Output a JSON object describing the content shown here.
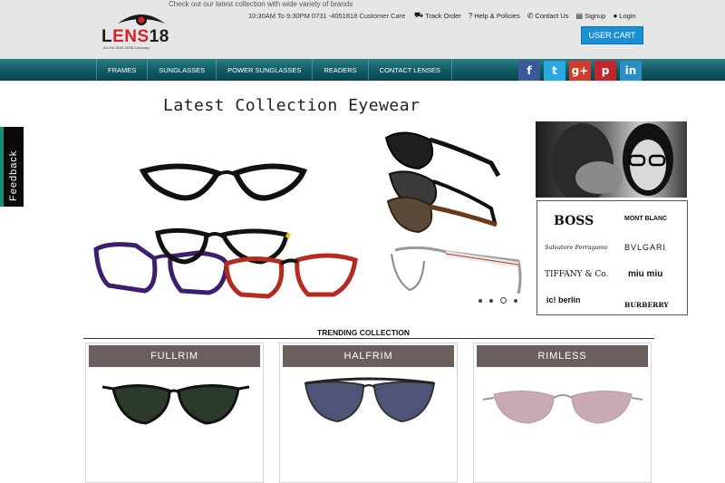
{
  "header": {
    "promo_text": "Check out our latest collection with wide variety of brands",
    "logo_text_a": "L",
    "logo_text_b": "ENS",
    "logo_text_c": "18",
    "logo_tagline": "An ISO 9001:2008 Company",
    "hours": "10:30AM To 9:30PM 0731 -4051818 Customer Care",
    "links": {
      "track_order": "Track Order",
      "help": "Help & Policies",
      "contact": "Contact Us",
      "signup": "Signup",
      "login": "Login"
    },
    "cart_label": "USER CART"
  },
  "nav": {
    "items": [
      "FRAMES",
      "SUNGLASSES",
      "POWER SUNGLASSES",
      "READERS",
      "CONTACT LENSES"
    ]
  },
  "social": {
    "facebook": "f",
    "twitter": "t",
    "googleplus": "g+",
    "pinterest": "p",
    "linkedin": "in"
  },
  "feedback_label": "Feedback",
  "hero": {
    "title": "Latest Collection Eyewear"
  },
  "brands": [
    "BOSS",
    "MONT BLANC",
    "Salvatore Ferragamo",
    "BVLGARI",
    "TIFFANY & Co.",
    "miu miu",
    "ic! berlin",
    "BURBERRY"
  ],
  "trending": {
    "title": "TRENDING COLLECTION",
    "cards": [
      "FULLRIM",
      "HALFRIM",
      "RIMLESS"
    ]
  },
  "colors": {
    "nav_teal": "#0f5860",
    "cart_blue": "#1b8fd6",
    "card_header": "#6a5f5c"
  }
}
